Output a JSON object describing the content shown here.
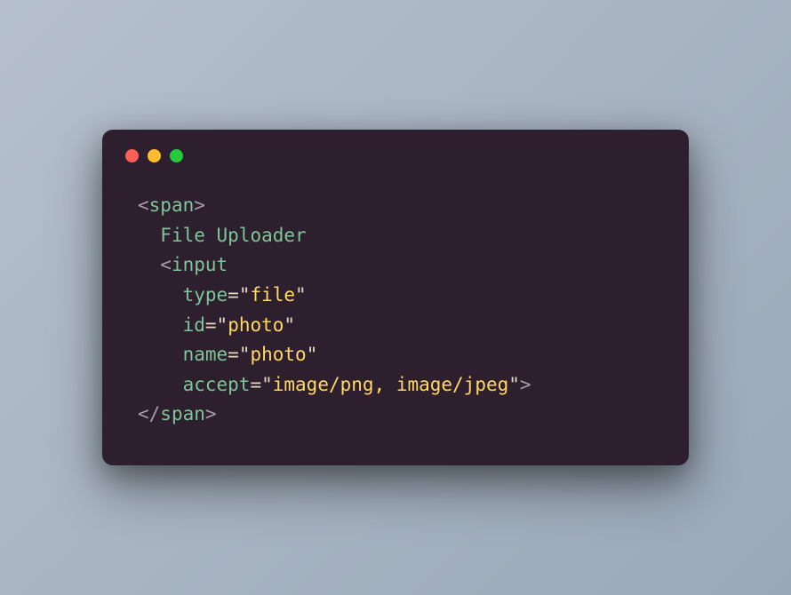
{
  "code": {
    "line1": {
      "open_bracket": "<",
      "tag": "span",
      "close_bracket": ">"
    },
    "line2": {
      "indent": "  ",
      "text": "File Uploader"
    },
    "line3": {
      "indent": "  ",
      "open_bracket": "<",
      "tag": "input"
    },
    "line4": {
      "indent": "    ",
      "attr": "type",
      "eq": "=",
      "quote1": "\"",
      "val": "file",
      "quote2": "\""
    },
    "line5": {
      "indent": "    ",
      "attr": "id",
      "eq": "=",
      "quote1": "\"",
      "val": "photo",
      "quote2": "\""
    },
    "line6": {
      "indent": "    ",
      "attr": "name",
      "eq": "=",
      "quote1": "\"",
      "val": "photo",
      "quote2": "\""
    },
    "line7": {
      "indent": "    ",
      "attr": "accept",
      "eq": "=",
      "quote1": "\"",
      "val": "image/png, image/jpeg",
      "quote2": "\"",
      "close_bracket": ">"
    },
    "line8": {
      "open_bracket": "</",
      "tag": "span",
      "close_bracket": ">"
    }
  }
}
